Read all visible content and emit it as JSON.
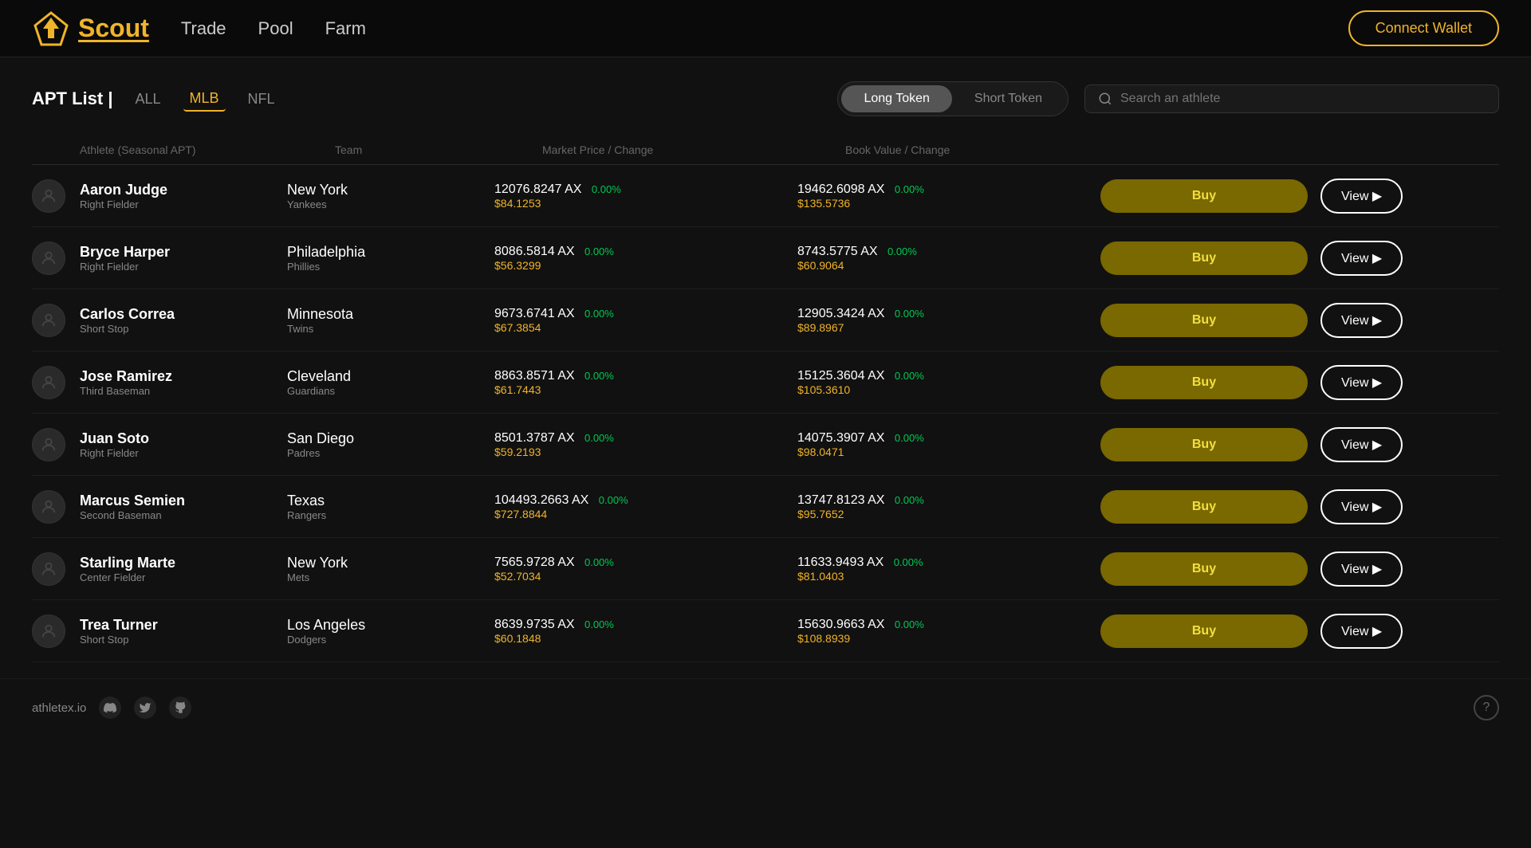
{
  "header": {
    "logo_text": "Scout",
    "nav": [
      "Trade",
      "Pool",
      "Farm"
    ],
    "connect_wallet_label": "Connect Wallet"
  },
  "apt_list": {
    "title": "APT List |",
    "filters": [
      {
        "label": "ALL",
        "active": false
      },
      {
        "label": "MLB",
        "active": true
      },
      {
        "label": "NFL",
        "active": false
      }
    ],
    "token_toggle": {
      "long_label": "Long Token",
      "short_label": "Short Token",
      "active": "Long Token"
    },
    "search_placeholder": "Search an athlete",
    "table_headers": {
      "athlete": "Athlete (Seasonal APT)",
      "team": "Team",
      "market_price": "Market Price / Change",
      "book_value": "Book Value / Change"
    },
    "athletes": [
      {
        "name": "Aaron Judge",
        "position": "Right Fielder",
        "team_city": "New York",
        "team_name": "Yankees",
        "market_ax": "12076.8247 AX",
        "market_change": "0.00%",
        "market_usd": "$84.1253",
        "book_ax": "19462.6098 AX",
        "book_change": "0.00%",
        "book_usd": "$135.5736"
      },
      {
        "name": "Bryce Harper",
        "position": "Right Fielder",
        "team_city": "Philadelphia",
        "team_name": "Phillies",
        "market_ax": "8086.5814 AX",
        "market_change": "0.00%",
        "market_usd": "$56.3299",
        "book_ax": "8743.5775 AX",
        "book_change": "0.00%",
        "book_usd": "$60.9064"
      },
      {
        "name": "Carlos Correa",
        "position": "Short Stop",
        "team_city": "Minnesota",
        "team_name": "Twins",
        "market_ax": "9673.6741 AX",
        "market_change": "0.00%",
        "market_usd": "$67.3854",
        "book_ax": "12905.3424 AX",
        "book_change": "0.00%",
        "book_usd": "$89.8967"
      },
      {
        "name": "Jose Ramirez",
        "position": "Third Baseman",
        "team_city": "Cleveland",
        "team_name": "Guardians",
        "market_ax": "8863.8571 AX",
        "market_change": "0.00%",
        "market_usd": "$61.7443",
        "book_ax": "15125.3604 AX",
        "book_change": "0.00%",
        "book_usd": "$105.3610"
      },
      {
        "name": "Juan Soto",
        "position": "Right Fielder",
        "team_city": "San Diego",
        "team_name": "Padres",
        "market_ax": "8501.3787 AX",
        "market_change": "0.00%",
        "market_usd": "$59.2193",
        "book_ax": "14075.3907 AX",
        "book_change": "0.00%",
        "book_usd": "$98.0471"
      },
      {
        "name": "Marcus Semien",
        "position": "Second Baseman",
        "team_city": "Texas",
        "team_name": "Rangers",
        "market_ax": "104493.2663 AX",
        "market_change": "0.00%",
        "market_usd": "$727.8844",
        "book_ax": "13747.8123 AX",
        "book_change": "0.00%",
        "book_usd": "$95.7652"
      },
      {
        "name": "Starling Marte",
        "position": "Center Fielder",
        "team_city": "New York",
        "team_name": "Mets",
        "market_ax": "7565.9728 AX",
        "market_change": "0.00%",
        "market_usd": "$52.7034",
        "book_ax": "11633.9493 AX",
        "book_change": "0.00%",
        "book_usd": "$81.0403"
      },
      {
        "name": "Trea Turner",
        "position": "Short Stop",
        "team_city": "Los Angeles",
        "team_name": "Dodgers",
        "market_ax": "8639.9735 AX",
        "market_change": "0.00%",
        "market_usd": "$60.1848",
        "book_ax": "15630.9663 AX",
        "book_change": "0.00%",
        "book_usd": "$108.8939"
      }
    ]
  },
  "footer": {
    "brand": "athletex.io",
    "help_icon": "?"
  },
  "buttons": {
    "buy_label": "Buy",
    "view_label": "View ▶"
  }
}
